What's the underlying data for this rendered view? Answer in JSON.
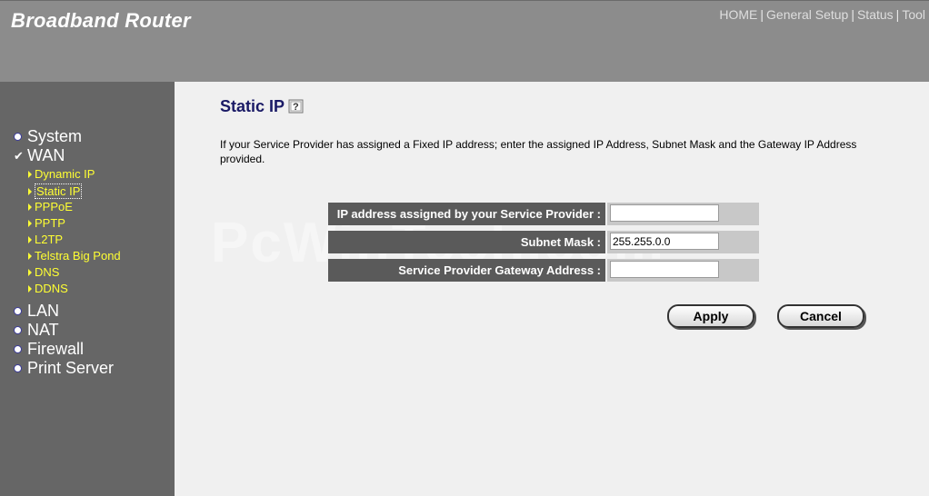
{
  "header": {
    "brand": "Broadband Router",
    "nav": [
      "HOME",
      "General Setup",
      "Status",
      "Tool"
    ]
  },
  "sidebar": {
    "main_items": [
      "System",
      "WAN",
      "LAN",
      "NAT",
      "Firewall",
      "Print Server"
    ],
    "wan_sub_items": [
      "Dynamic IP",
      "Static IP",
      "PPPoE",
      "PPTP",
      "L2TP",
      "Telstra Big Pond",
      "DNS",
      "DDNS"
    ],
    "active_sub_item": "Static IP"
  },
  "content": {
    "title": "Static IP",
    "description": "If your Service Provider has assigned a Fixed IP address; enter the assigned IP Address, Subnet Mask and the Gateway IP Address provided.",
    "watermark": "PcWinTech.com",
    "fields": [
      {
        "label": "IP address assigned by your Service Provider :",
        "value": ""
      },
      {
        "label": "Subnet Mask :",
        "value": "255.255.0.0"
      },
      {
        "label": "Service Provider Gateway Address :",
        "value": ""
      }
    ],
    "apply_label": "Apply",
    "cancel_label": "Cancel"
  },
  "colors": {
    "header_bg": "#8c8c8c",
    "sidebar_bg": "#666666",
    "sub_item_text": "#ffff33",
    "title_text": "#1a1a66",
    "label_bg": "#5a5a5a",
    "field_bg": "#c8c8c8"
  },
  "icons": [
    "help-icon",
    "bullet-dot-icon",
    "checkmark-icon",
    "arrow-right-icon"
  ]
}
